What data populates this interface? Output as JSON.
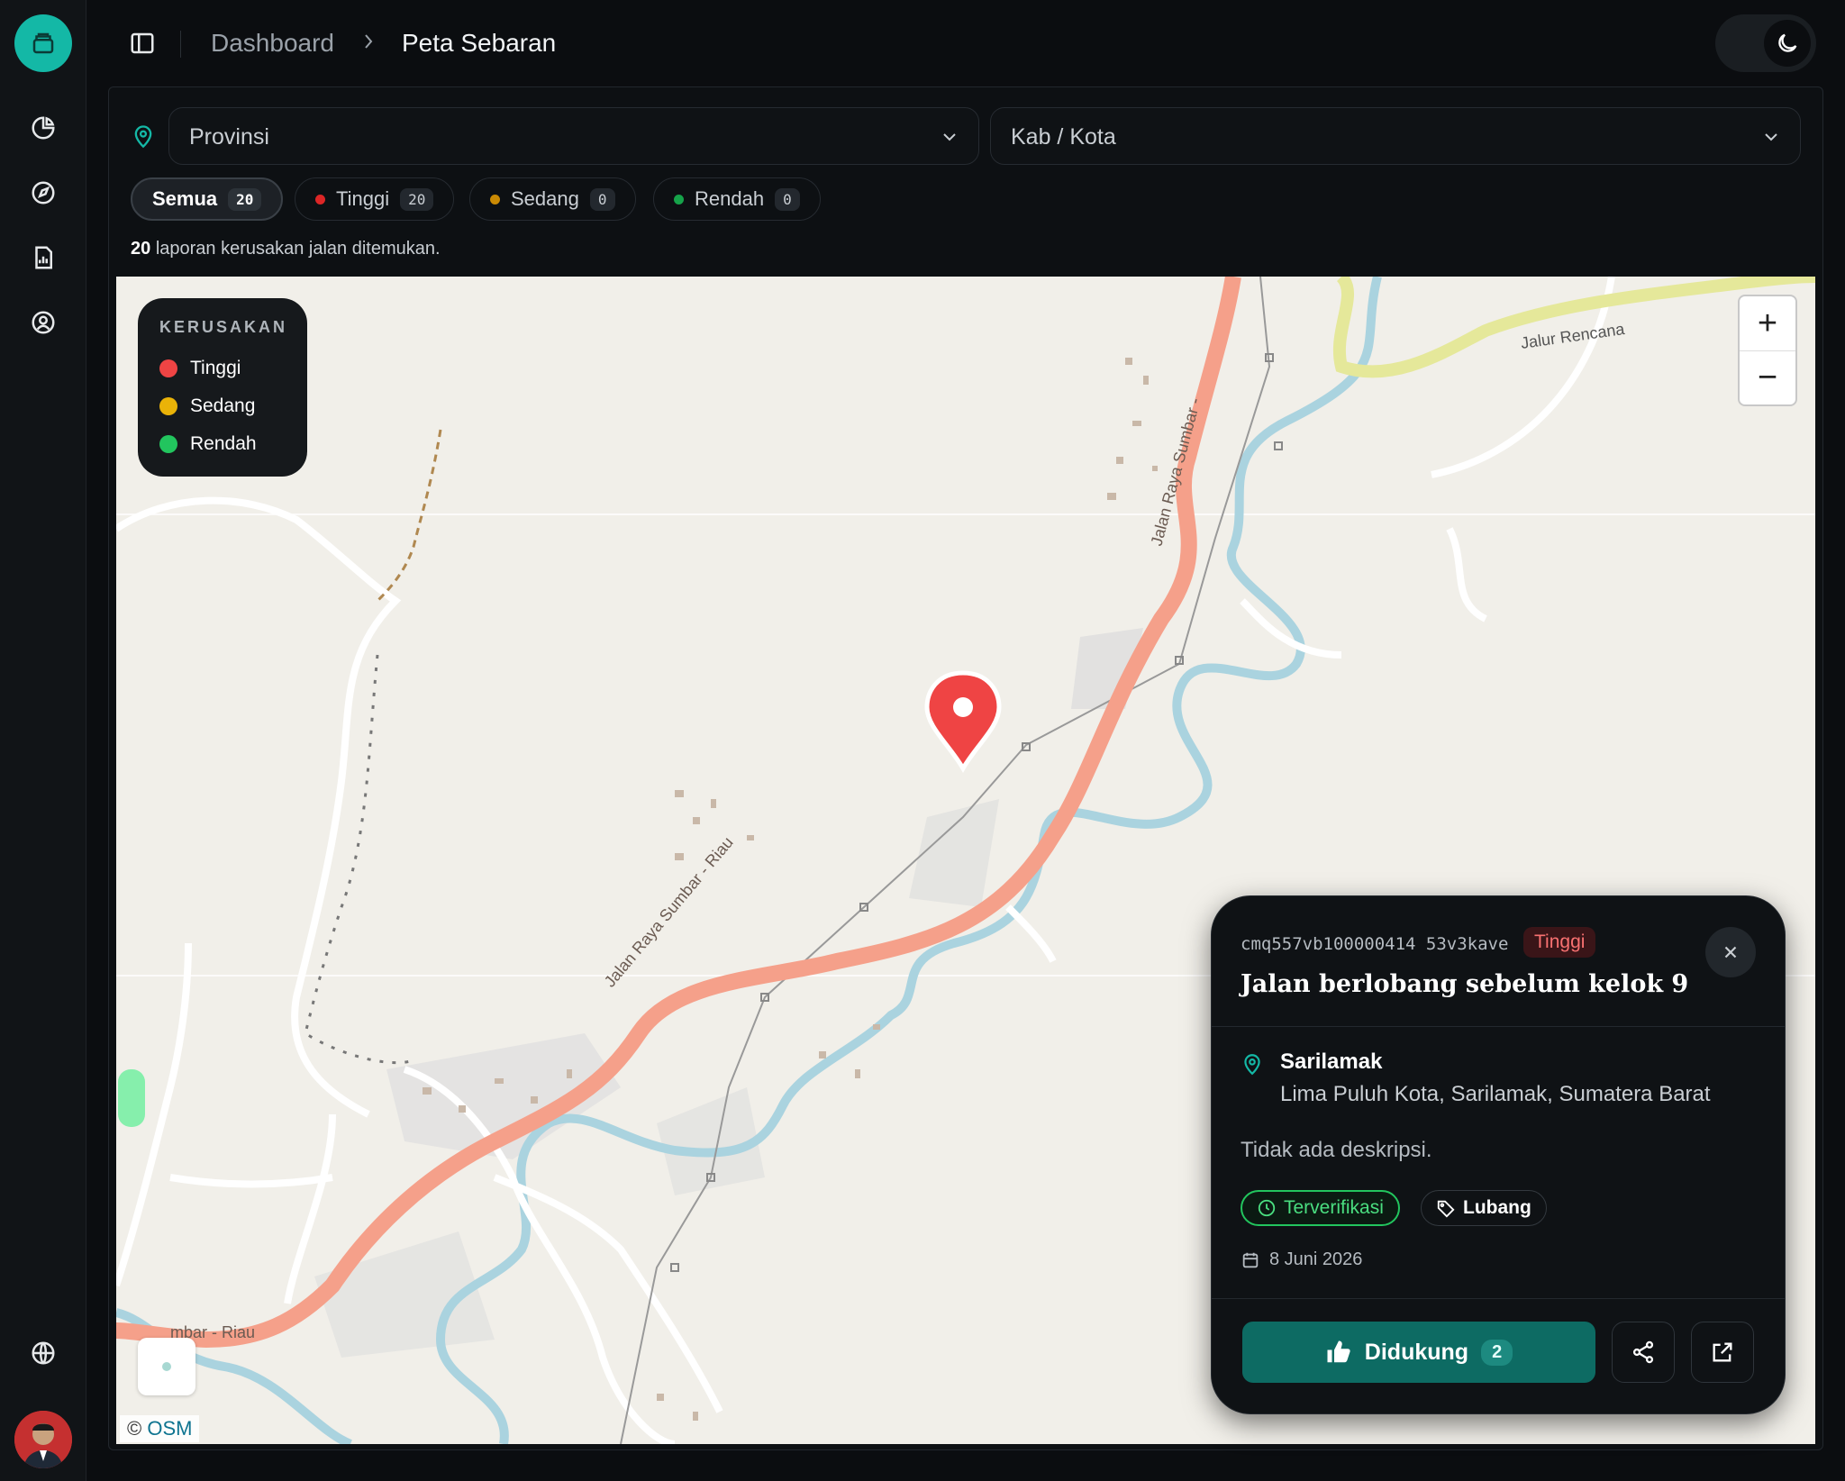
{
  "header": {
    "breadcrumb_parent": "Dashboard",
    "breadcrumb_current": "Peta Sebaran"
  },
  "filters": {
    "province_placeholder": "Provinsi",
    "city_placeholder": "Kab / Kota"
  },
  "severity_chips": [
    {
      "label": "Semua",
      "count": "20",
      "color": ""
    },
    {
      "label": "Tinggi",
      "count": "20",
      "color": "#ef4444"
    },
    {
      "label": "Sedang",
      "count": "0",
      "color": "#eab308"
    },
    {
      "label": "Rendah",
      "count": "0",
      "color": "#22c55e"
    }
  ],
  "report_summary": {
    "count": "20",
    "text": "laporan kerusakan jalan ditemukan."
  },
  "legend": {
    "title": "KERUSAKAN",
    "items": [
      {
        "label": "Tinggi",
        "color": "#ef4444"
      },
      {
        "label": "Sedang",
        "color": "#eab308"
      },
      {
        "label": "Rendah",
        "color": "#22c55e"
      }
    ]
  },
  "map": {
    "zoom_in": "+",
    "zoom_out": "−",
    "attribution_prefix": "©",
    "attribution_link": "OSM",
    "road_labels": [
      "Jalan Raya Sumbar - Riau",
      "Jalan Raya Sumbar - Riau",
      "Jalan Raya Sumbar -",
      "Jalur Rencana",
      "mbar - Riau"
    ]
  },
  "popup": {
    "report_id": "cmq557vb100000414 53v3kave",
    "severity": "Tinggi",
    "title": "Jalan berlobang sebelum kelok 9",
    "location_name": "Sarilamak",
    "location_detail": "Lima Puluh Kota, Sarilamak, Sumatera Barat",
    "description": "Tidak ada deskripsi.",
    "status": "Terverifikasi",
    "category": "Lubang",
    "date": "8 Juni 2026",
    "support_label": "Didukung",
    "support_count": "2"
  }
}
